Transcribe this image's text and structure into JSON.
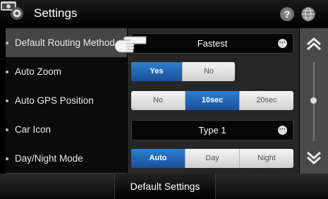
{
  "header": {
    "title": "Settings",
    "icons": [
      "gear-icon",
      "folder-icon",
      "help-icon",
      "globe-icon"
    ],
    "help_glyph": "?"
  },
  "sidebar": {
    "items": [
      {
        "label": "Default Routing Method",
        "active": true
      },
      {
        "label": "Auto Zoom",
        "active": false
      },
      {
        "label": "Auto GPS Position",
        "active": false
      },
      {
        "label": "Car Icon",
        "active": false
      },
      {
        "label": "Day/Night Mode",
        "active": false
      }
    ]
  },
  "settings": {
    "routing": {
      "value": "Fastest",
      "icon": "dropdown-dots-icon"
    },
    "auto_zoom": {
      "options": [
        "Yes",
        "No"
      ],
      "selected": "Yes"
    },
    "gps_position": {
      "options": [
        "No",
        "10sec",
        "20sec"
      ],
      "selected": "10sec"
    },
    "car_icon": {
      "value": "Type 1",
      "icon": "dropdown-dots-icon"
    },
    "day_night": {
      "options": [
        "Auto",
        "Day",
        "Night"
      ],
      "selected": "Auto"
    }
  },
  "footer": {
    "default_settings_label": "Default Settings"
  },
  "colors": {
    "selected_blue": "#1f5fb0",
    "panel": "#262626",
    "active_item": "#454545"
  }
}
